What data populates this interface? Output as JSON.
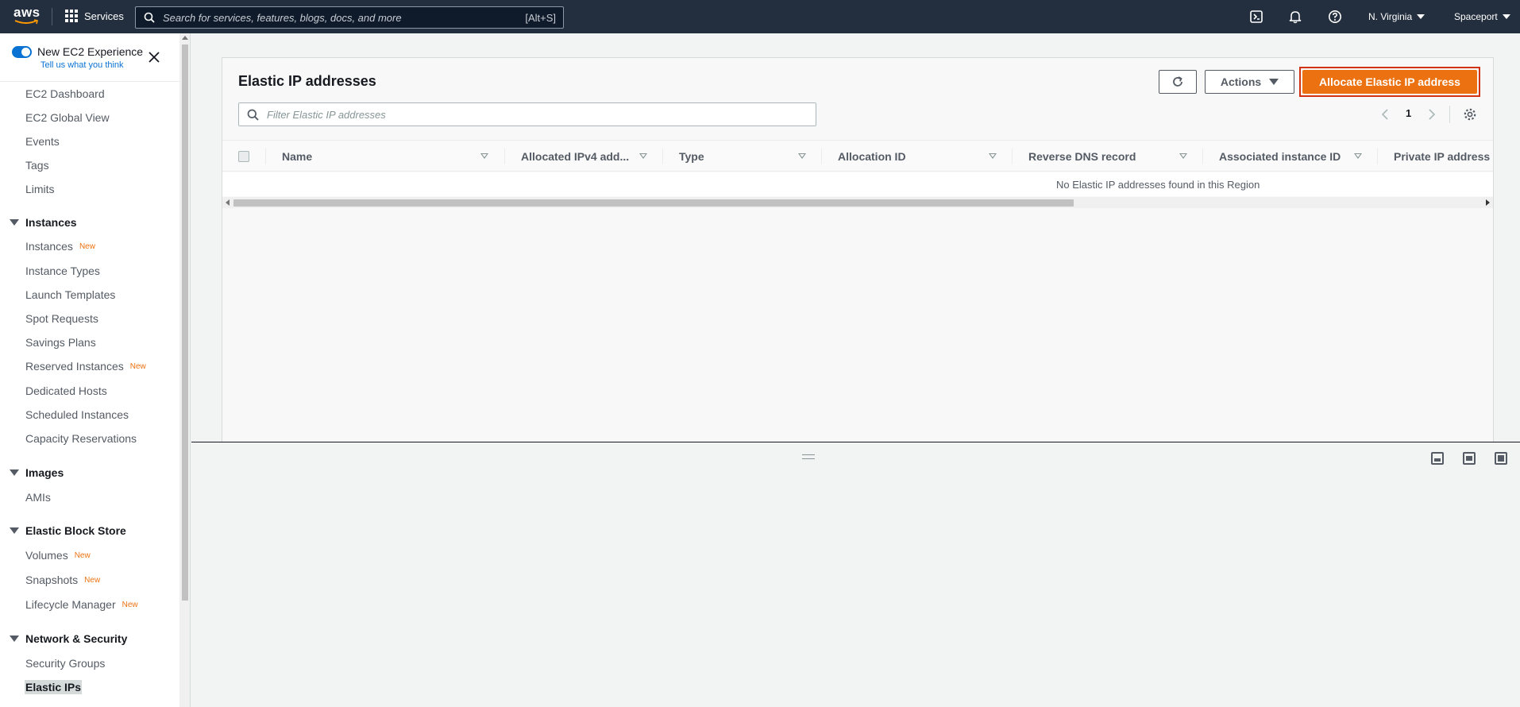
{
  "topnav": {
    "logo_text": "aws",
    "services_label": "Services",
    "search_placeholder": "Search for services, features, blogs, docs, and more",
    "search_shortcut": "[Alt+S]",
    "region": "N. Virginia",
    "account": "Spaceport",
    "icons": [
      "cloudshell-icon",
      "bell-icon",
      "help-icon"
    ]
  },
  "sidebar": {
    "experience_title": "New EC2 Experience",
    "experience_link": "Tell us what you think",
    "top_items": [
      {
        "label": "EC2 Dashboard"
      },
      {
        "label": "EC2 Global View"
      },
      {
        "label": "Events"
      },
      {
        "label": "Tags"
      },
      {
        "label": "Limits"
      }
    ],
    "sections": [
      {
        "title": "Instances",
        "items": [
          {
            "label": "Instances",
            "badge": "New"
          },
          {
            "label": "Instance Types",
            "badge": ""
          },
          {
            "label": "Launch Templates",
            "badge": ""
          },
          {
            "label": "Spot Requests",
            "badge": ""
          },
          {
            "label": "Savings Plans",
            "badge": ""
          },
          {
            "label": "Reserved Instances",
            "badge": "New"
          },
          {
            "label": "Dedicated Hosts",
            "badge": ""
          },
          {
            "label": "Scheduled Instances",
            "badge": ""
          },
          {
            "label": "Capacity Reservations",
            "badge": ""
          }
        ]
      },
      {
        "title": "Images",
        "items": [
          {
            "label": "AMIs",
            "badge": ""
          }
        ]
      },
      {
        "title": "Elastic Block Store",
        "items": [
          {
            "label": "Volumes",
            "badge": "New"
          },
          {
            "label": "Snapshots",
            "badge": "New"
          },
          {
            "label": "Lifecycle Manager",
            "badge": "New"
          }
        ]
      },
      {
        "title": "Network & Security",
        "items": [
          {
            "label": "Security Groups",
            "badge": ""
          },
          {
            "label": "Elastic IPs",
            "badge": ""
          }
        ]
      }
    ],
    "active_item": "Elastic IPs"
  },
  "main": {
    "title": "Elastic IP addresses",
    "actions_label": "Actions",
    "allocate_label": "Allocate Elastic IP address",
    "filter_placeholder": "Filter Elastic IP addresses",
    "page_number": "1",
    "columns": [
      "Name",
      "Allocated IPv4 add...",
      "Type",
      "Allocation ID",
      "Reverse DNS record",
      "Associated instance ID",
      "Private IP address"
    ],
    "empty_message": "No Elastic IP addresses found in this Region"
  },
  "colors": {
    "nav_bg": "#232f3e",
    "primary": "#ec7211",
    "focus_outline": "#d13212",
    "link": "#0972d3"
  }
}
